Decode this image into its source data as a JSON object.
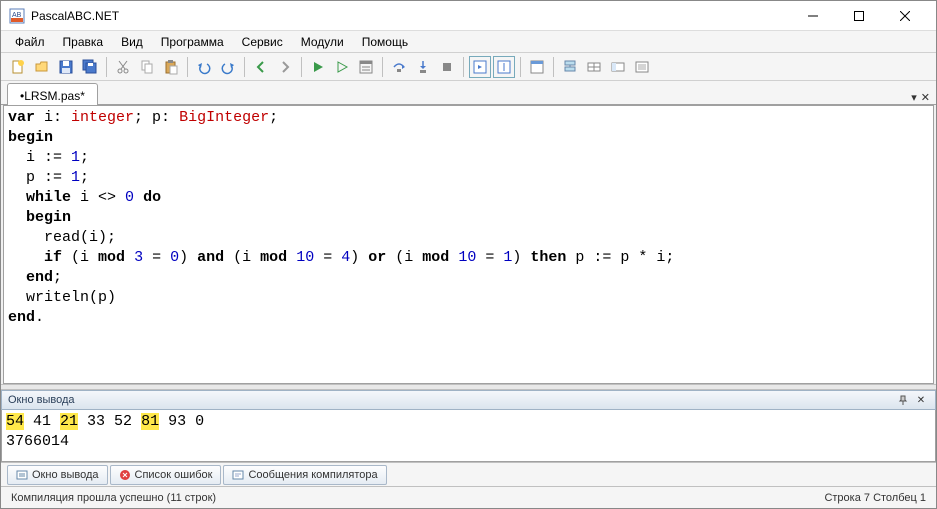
{
  "window": {
    "title": "PascalABC.NET"
  },
  "menu": {
    "items": [
      "Файл",
      "Правка",
      "Вид",
      "Программа",
      "Сервис",
      "Модули",
      "Помощь"
    ]
  },
  "tabs": {
    "active": "•LRSM.pas*"
  },
  "code": {
    "lines": [
      {
        "tokens": [
          [
            "kw",
            "var"
          ],
          [
            "plain",
            " i: "
          ],
          [
            "typ",
            "integer"
          ],
          [
            "plain",
            "; p: "
          ],
          [
            "typ",
            "BigInteger"
          ],
          [
            "plain",
            ";"
          ]
        ]
      },
      {
        "tokens": [
          [
            "kw",
            "begin"
          ]
        ]
      },
      {
        "tokens": [
          [
            "plain",
            "  i := "
          ],
          [
            "num",
            "1"
          ],
          [
            "plain",
            ";"
          ]
        ]
      },
      {
        "tokens": [
          [
            "plain",
            "  p := "
          ],
          [
            "num",
            "1"
          ],
          [
            "plain",
            ";"
          ]
        ]
      },
      {
        "tokens": [
          [
            "plain",
            "  "
          ],
          [
            "kw",
            "while"
          ],
          [
            "plain",
            " i <> "
          ],
          [
            "num",
            "0"
          ],
          [
            "plain",
            " "
          ],
          [
            "kw",
            "do"
          ]
        ]
      },
      {
        "tokens": [
          [
            "plain",
            "  "
          ],
          [
            "kw",
            "begin"
          ]
        ]
      },
      {
        "tokens": [
          [
            "plain",
            "    read(i);"
          ]
        ]
      },
      {
        "tokens": [
          [
            "plain",
            "    "
          ],
          [
            "kw",
            "if"
          ],
          [
            "plain",
            " (i "
          ],
          [
            "kw",
            "mod"
          ],
          [
            "plain",
            " "
          ],
          [
            "num",
            "3"
          ],
          [
            "plain",
            " = "
          ],
          [
            "num",
            "0"
          ],
          [
            "plain",
            ") "
          ],
          [
            "kw",
            "and"
          ],
          [
            "plain",
            " (i "
          ],
          [
            "kw",
            "mod"
          ],
          [
            "plain",
            " "
          ],
          [
            "num",
            "10"
          ],
          [
            "plain",
            " = "
          ],
          [
            "num",
            "4"
          ],
          [
            "plain",
            ") "
          ],
          [
            "kw",
            "or"
          ],
          [
            "plain",
            " (i "
          ],
          [
            "kw",
            "mod"
          ],
          [
            "plain",
            " "
          ],
          [
            "num",
            "10"
          ],
          [
            "plain",
            " = "
          ],
          [
            "num",
            "1"
          ],
          [
            "plain",
            ") "
          ],
          [
            "kw",
            "then"
          ],
          [
            "plain",
            " p := p * i;"
          ]
        ]
      },
      {
        "tokens": [
          [
            "plain",
            "  "
          ],
          [
            "kw",
            "end"
          ],
          [
            "plain",
            ";"
          ]
        ]
      },
      {
        "tokens": [
          [
            "plain",
            "  writeln(p)"
          ]
        ]
      },
      {
        "tokens": [
          [
            "kw",
            "end"
          ],
          [
            "plain",
            "."
          ]
        ]
      }
    ]
  },
  "output": {
    "header": "Окно вывода",
    "line1_tokens": [
      {
        "text": "54",
        "hl": true
      },
      {
        "text": " 41 ",
        "hl": false
      },
      {
        "text": "21",
        "hl": true
      },
      {
        "text": " 33 52 ",
        "hl": false
      },
      {
        "text": "81",
        "hl": true
      },
      {
        "text": " 93 0",
        "hl": false
      }
    ],
    "line2": "3766014"
  },
  "bottom_tabs": {
    "output": "Окно вывода",
    "errors": "Список ошибок",
    "messages": "Сообщения компилятора"
  },
  "status": {
    "left": "Компиляция прошла успешно (11 строк)",
    "right": "Строка  7 Столбец  1"
  }
}
